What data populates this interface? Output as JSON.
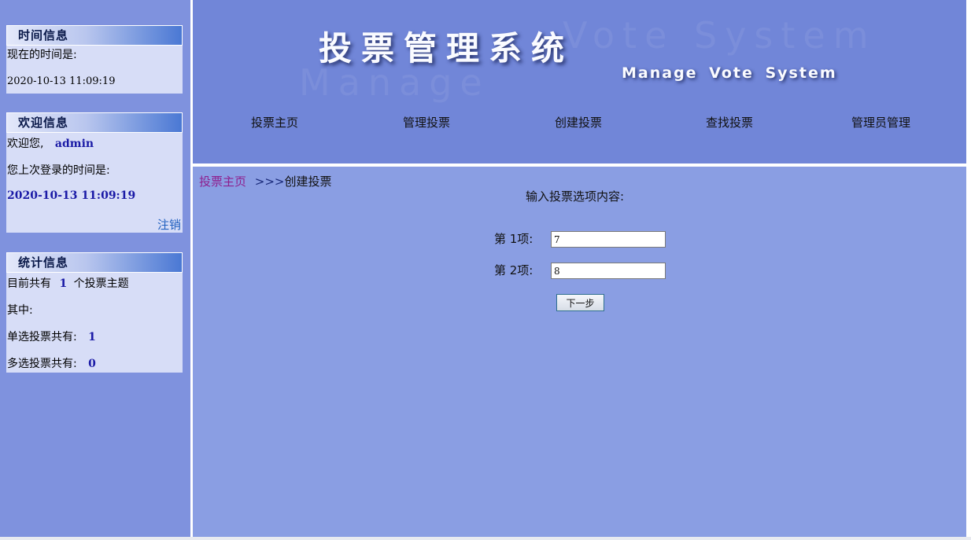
{
  "sidebar": {
    "time_panel": {
      "title": "时间信息",
      "label": "现在的时间是:",
      "value": "2020-10-13 11:09:19"
    },
    "welcome_panel": {
      "title": "欢迎信息",
      "greeting": "欢迎您,",
      "username": "admin",
      "last_login_label": "您上次登录的时间是:",
      "last_login_value": "2020-10-13 11:09:19",
      "logout_label": "注销"
    },
    "stats_panel": {
      "title": "统计信息",
      "total_prefix": "目前共有",
      "total_count": "1",
      "total_suffix": "个投票主题",
      "among_label": "其中:",
      "single_label": "单选投票共有:",
      "single_count": "1",
      "multi_label": "多选投票共有:",
      "multi_count": "0"
    }
  },
  "header": {
    "title": "投票管理系统",
    "subtitle": "Manage  Vote  System",
    "watermark_1": "Manage",
    "watermark_2": "Vote System",
    "nav": [
      "投票主页",
      "管理投票",
      "创建投票",
      "查找投票",
      "管理员管理"
    ]
  },
  "main": {
    "breadcrumb": {
      "link": "投票主页",
      "separator": ">>>",
      "current": "创建投票"
    },
    "form_title": "输入投票选项内容:",
    "options": [
      {
        "label": "第  1项:",
        "value": "7"
      },
      {
        "label": "第  2项:",
        "value": "8"
      }
    ],
    "next_button": "下一步"
  },
  "colors": {
    "sidebar_bg": "#7f92de",
    "panel_bg": "#d7ddf7",
    "header_bg": "#7186d8",
    "main_bg": "#8a9ee3",
    "link_purple": "#8e1f8e",
    "value_blue": "#1a1aa6"
  }
}
